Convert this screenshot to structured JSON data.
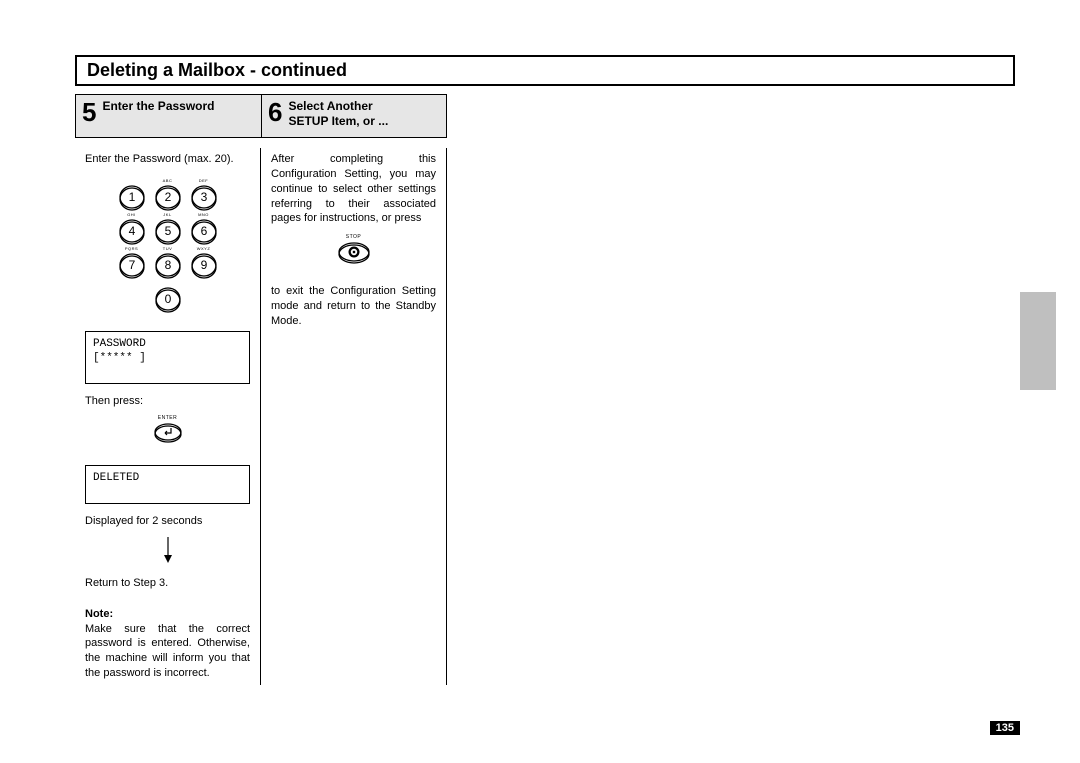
{
  "title": "Deleting a Mailbox - continued",
  "step5": {
    "num": "5",
    "title": "Enter the Password"
  },
  "step6": {
    "num": "6",
    "title": "Select Another\nSETUP Item, or ..."
  },
  "col5": {
    "intro": "Enter the Password (max. 20).",
    "keypad": {
      "labels": [
        "",
        "ABC",
        "DEF",
        "GHI",
        "JKL",
        "MNO",
        "PQRS",
        "TUV",
        "WXYZ",
        ""
      ],
      "digits": [
        "1",
        "2",
        "3",
        "4",
        "5",
        "6",
        "7",
        "8",
        "9",
        "0"
      ]
    },
    "display1_line1": "PASSWORD",
    "display1_line2": "[*****            ]",
    "then_press": "Then press:",
    "enter_label": "ENTER",
    "display2_line1": "DELETED",
    "displayed_for": "Displayed for 2 seconds",
    "return_step": "Return to Step 3.",
    "note_head": "Note:",
    "note_body": "Make sure that the correct password is entered. Otherwise, the machine will inform you that the password is incorrect."
  },
  "col6": {
    "para1": "After completing this Configuration Setting, you may continue to select other settings referring to their associated pages for instructions, or press",
    "stop_label": "STOP",
    "para2": "to exit the Configuration Setting mode and return to the Standby Mode."
  },
  "page_number": "135"
}
